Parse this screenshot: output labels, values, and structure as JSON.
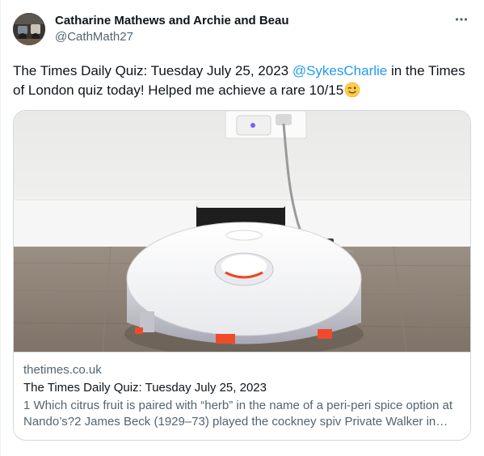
{
  "tweet": {
    "author": {
      "display_name": "Catharine Mathews and Archie and Beau",
      "handle": "@CathMath27"
    },
    "text_before": "The Times Daily Quiz: Tuesday July 25, 2023 ",
    "mention": "@SykesCharlie",
    "text_after": " in the Times of London quiz today! Helped me achieve a rare 10/15",
    "emoji_icon": "winking-face-icon"
  },
  "card": {
    "domain": "thetimes.co.uk",
    "title": "The Times Daily Quiz: Tuesday July 25, 2023",
    "description": "1 Which citrus fruit is paired with “herb” in the name of a peri-peri spice option at Nando’s?2 James Beck (1929–73) played the cockney spiv Private Walker in Dad’s Army…"
  },
  "colors": {
    "link": "#1d9bf0",
    "text_primary": "#0f1419",
    "text_secondary": "#536471",
    "border": "#cfd9de"
  }
}
